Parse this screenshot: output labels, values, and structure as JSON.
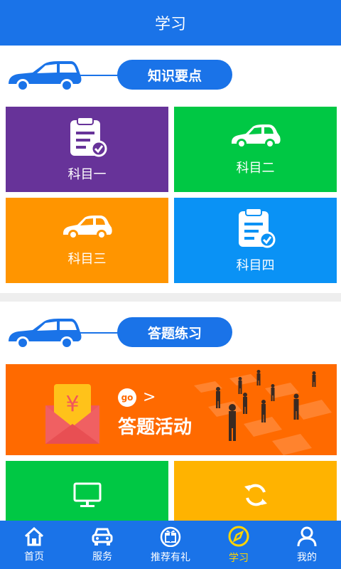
{
  "header": {
    "title": "学习"
  },
  "sections": {
    "knowledge": {
      "title": "知识要点"
    },
    "practice": {
      "title": "答题练习"
    }
  },
  "tiles": [
    {
      "label": "科目一",
      "icon": "clipboard-check-icon",
      "color": "#673399"
    },
    {
      "label": "科目二",
      "icon": "car-icon",
      "color": "#00c844"
    },
    {
      "label": "科目三",
      "icon": "car-icon",
      "color": "#ff9500"
    },
    {
      "label": "科目四",
      "icon": "clipboard-check-icon",
      "color": "#0a92f5"
    }
  ],
  "banner": {
    "badge": "go",
    "arrow": ">",
    "title": "答题活动",
    "yen": "¥",
    "color": "#ff6a00"
  },
  "extra_tiles": [
    {
      "icon": "monitor-icon",
      "color": "#00c844"
    },
    {
      "icon": "refresh-icon",
      "color": "#ffb300"
    }
  ],
  "nav": [
    {
      "label": "首页",
      "icon": "home-icon"
    },
    {
      "label": "服务",
      "icon": "car-front-icon"
    },
    {
      "label": "推荐有礼",
      "icon": "gift-icon"
    },
    {
      "label": "学习",
      "icon": "compass-icon",
      "active": true
    },
    {
      "label": "我的",
      "icon": "user-icon"
    }
  ],
  "colors": {
    "primary": "#1a73e8",
    "active_nav": "#ffd400"
  }
}
